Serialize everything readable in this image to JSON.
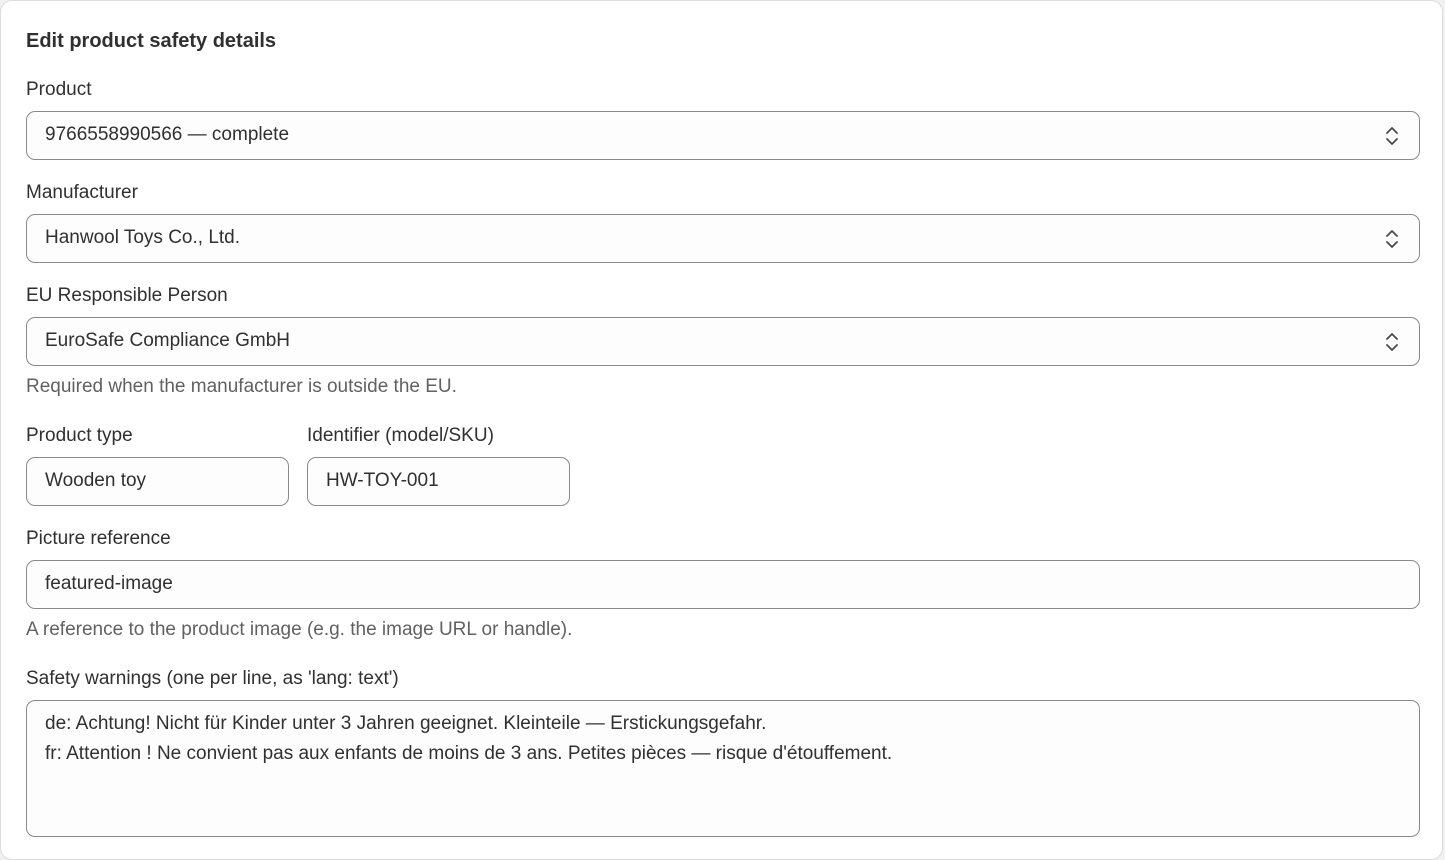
{
  "form": {
    "title": "Edit product safety details",
    "product": {
      "label": "Product",
      "value": "9766558990566 — complete",
      "icon": "select-chevrons-icon"
    },
    "manufacturer": {
      "label": "Manufacturer",
      "value": "Hanwool Toys Co., Ltd.",
      "icon": "select-chevrons-icon"
    },
    "eu_person": {
      "label": "EU Responsible Person",
      "value": "EuroSafe Compliance GmbH",
      "help": "Required when the manufacturer is outside the EU.",
      "icon": "select-chevrons-icon"
    },
    "product_type": {
      "label": "Product type",
      "value": "Wooden toy"
    },
    "identifier": {
      "label": "Identifier (model/SKU)",
      "value": "HW-TOY-001"
    },
    "picture": {
      "label": "Picture reference",
      "value": "featured-image",
      "help": "A reference to the product image (e.g. the image URL or handle)."
    },
    "warnings": {
      "label": "Safety warnings (one per line, as 'lang: text')",
      "lines": [
        "de: Achtung! Nicht für Kinder unter 3 Jahren geeignet. Kleinteile — Erstickungsgefahr.",
        "fr: Attention ! Ne convient pas aux enfants de moins de 3 ans. Petites pièces — risque d'étouffement."
      ]
    }
  },
  "colors": {
    "text": "#303030",
    "help_text": "#616161",
    "border": "#8a8a8a",
    "card_bg": "#ffffff"
  }
}
